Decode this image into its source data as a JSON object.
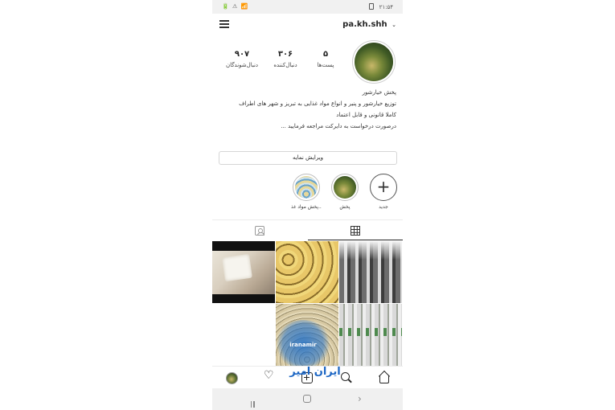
{
  "status_bar": {
    "left": "🔋 ⚠ 📶",
    "time": "۲۱:۵۴"
  },
  "header": {
    "username": "pa.kh.shh",
    "chevron": "⌄"
  },
  "stats": {
    "posts": {
      "value": "۵",
      "label": "پست‌ها"
    },
    "followers": {
      "value": "۳۰۶",
      "label": "دنبال‌کننده"
    },
    "following": {
      "value": "۹۰۷",
      "label": "دنبال‌شوندگان"
    }
  },
  "bio": {
    "line1": "پخش خیارشور",
    "line2": "توزیع خیارشور و پنیر و انواع مواد غذایی به تبریز و شهر های اطراف",
    "line3": "کاملا قانونی و قابل اعتماد",
    "line4": "درصورت درخواست به دایرکت مراجعه فرمایید ..."
  },
  "edit_profile_label": "ویرایش نمایه",
  "highlights": [
    {
      "label": "جدید",
      "icon": "plus-icon"
    },
    {
      "label": "پخش"
    },
    {
      "label": "پخش مواد غذ..."
    }
  ],
  "watermark": {
    "logo_text": "iranamir",
    "text": "ایران امیر"
  },
  "bottom_nav": {
    "heart": "♡"
  },
  "system_nav": {
    "back": "›"
  },
  "colors": {
    "accent": "#262626",
    "watermark_blue": "#1c66c4",
    "system_bar": "#f0f0f0"
  }
}
